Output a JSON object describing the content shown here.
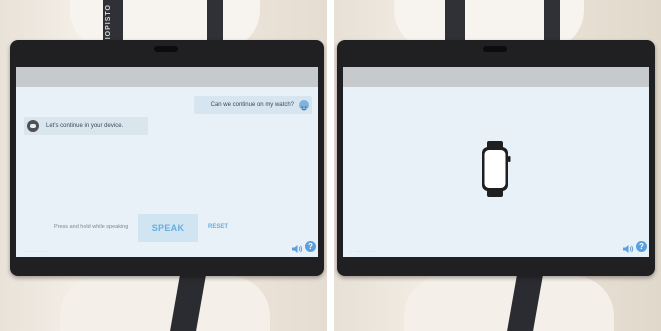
{
  "left_panel": {
    "strap_text": "LIOPISTO",
    "chat": {
      "user_message": "Can we continue on my watch?",
      "bot_message": "Let's continue in your device."
    },
    "controls": {
      "hint": "Press and hold while speaking",
      "speak_label": "SPEAK",
      "reset_label": "RESET"
    },
    "footer_text": "·· ······ ······",
    "help_label": "?"
  },
  "right_panel": {
    "footer_text": "·· ······ ······",
    "help_label": "?"
  },
  "icons": {
    "user_avatar": "smiley-icon",
    "bot_avatar": "robot-icon",
    "volume": "speaker-icon",
    "help": "help-icon",
    "watch": "smartwatch-icon"
  },
  "colors": {
    "accent": "#68aee1",
    "screen_bg": "#e8f1f7",
    "help_bg": "#5b9fdc"
  }
}
